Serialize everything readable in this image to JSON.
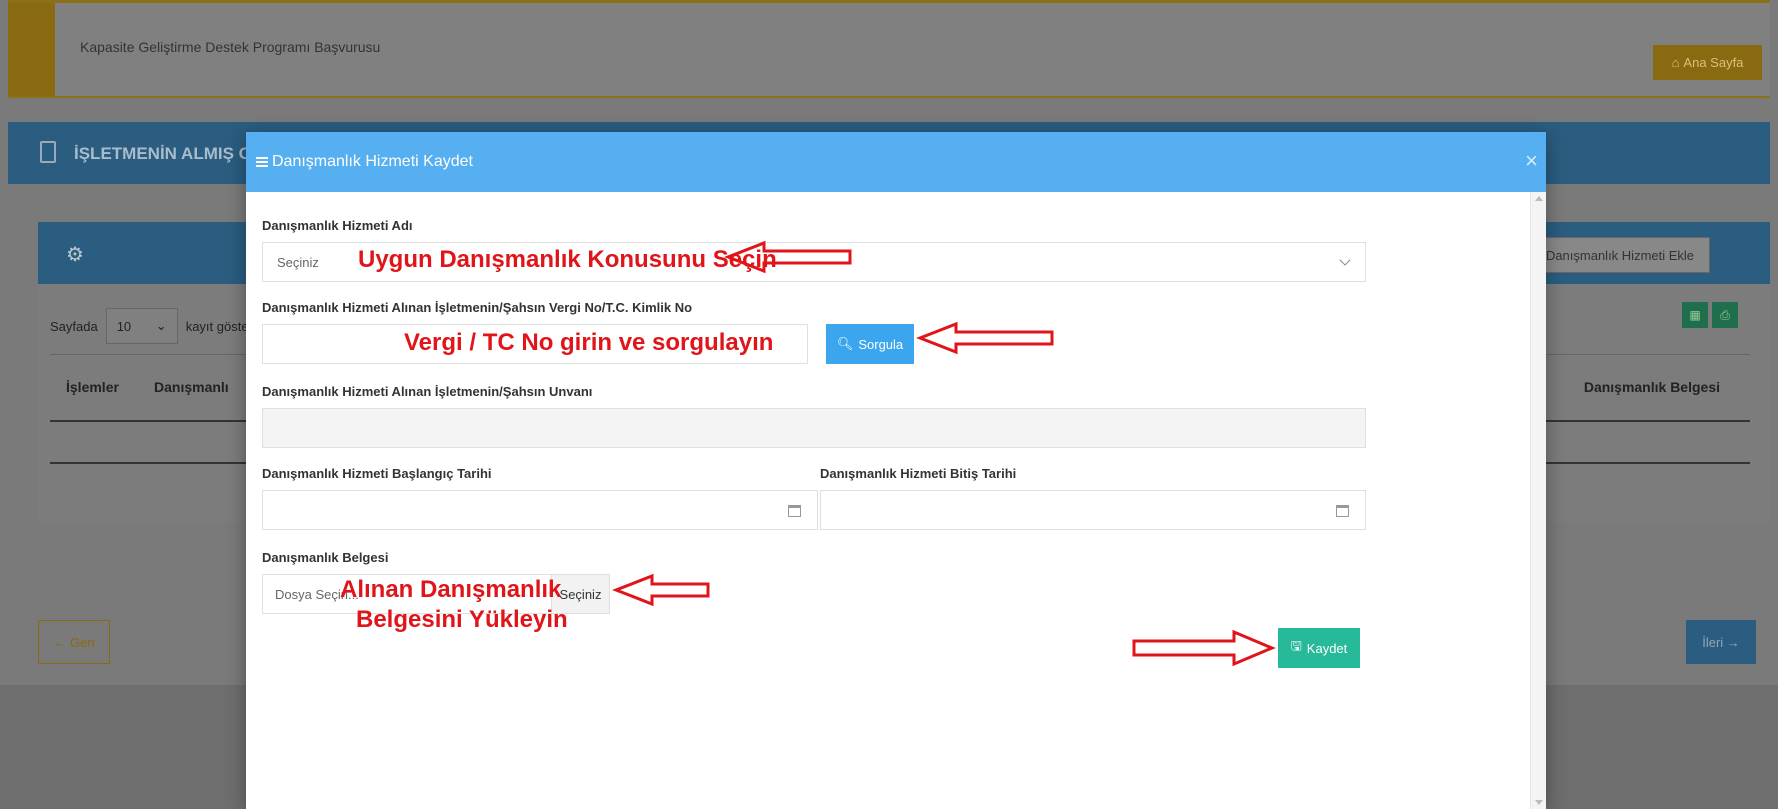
{
  "background": {
    "app_title": "Kapasite Geliştirme Destek Programı Başvurusu",
    "home_button": "Ana Sayfa",
    "section_title": "İŞLETMENİN ALMIŞ O",
    "add_button": "Danışmanlık Hizmeti Ekle",
    "per_page_prefix": "Sayfada",
    "per_page_value": "10",
    "per_page_suffix": "kayıt göste",
    "table_headers": {
      "actions": "İşlemler",
      "consultancy": "Danışmanlı",
      "document": "Danışmanlık Belgesi"
    },
    "back_button": "← Geri",
    "next_button": "İleri →"
  },
  "modal": {
    "title": "Danışmanlık Hizmeti Kaydet",
    "close": "×",
    "service_name_label": "Danışmanlık Hizmeti Adı",
    "service_name_placeholder": "Seçiniz",
    "tax_no_label": "Danışmanlık Hizmeti Alınan İşletmenin/Şahsın Vergi No/T.C. Kimlik No",
    "tax_no_value": "",
    "query_button": "Sorgula",
    "title_label": "Danışmanlık Hizmeti Alınan İşletmenin/Şahsın Unvanı",
    "title_value": "",
    "start_date_label": "Danışmanlık Hizmeti Başlangıç Tarihi",
    "end_date_label": "Danışmanlık Hizmeti Bitiş Tarihi",
    "document_label": "Danışmanlık Belgesi",
    "file_placeholder": "Dosya Seçin...",
    "file_button": "Seçiniz",
    "save_button": "Kaydet"
  },
  "annotations": {
    "select_topic": "Uygun Danışmanlık Konusunu Seçin",
    "enter_tax": "Vergi / TC No girin ve sorgulayın",
    "upload_line1": "Alınan Danışmanlık",
    "upload_line2": "Belgesini Yükleyin"
  },
  "colors": {
    "modal_header": "#55aff0",
    "query_button": "#3ba6ee",
    "save_button": "#26b99a",
    "annotation_red": "#e0151a"
  }
}
